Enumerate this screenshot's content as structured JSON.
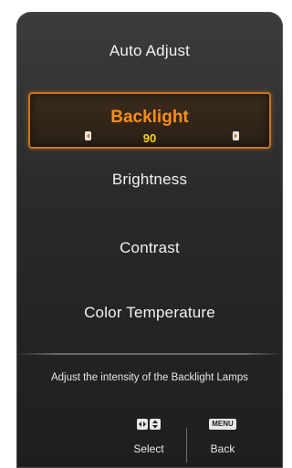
{
  "menu": {
    "items": [
      {
        "label": "Auto  Adjust"
      },
      {
        "label": "Backlight",
        "value": "90"
      },
      {
        "label": "Brightness"
      },
      {
        "label": "Contrast"
      },
      {
        "label": "Color  Temperature"
      }
    ],
    "selected_index": 1
  },
  "help_text": "Adjust the intensity of the Backlight Lamps",
  "footer": {
    "select_label": "Select",
    "back_label": "Back",
    "menu_key_label": "MENU"
  },
  "icons": {
    "left": "left-arrow-icon",
    "right": "right-arrow-icon",
    "select_keys": [
      "left-right-key-icon",
      "up-down-key-icon"
    ]
  },
  "colors": {
    "highlight_border": "#c8761a",
    "highlight_text": "#ff8c1a",
    "value_text": "#ffd21a",
    "panel": "#2a2a2a"
  }
}
